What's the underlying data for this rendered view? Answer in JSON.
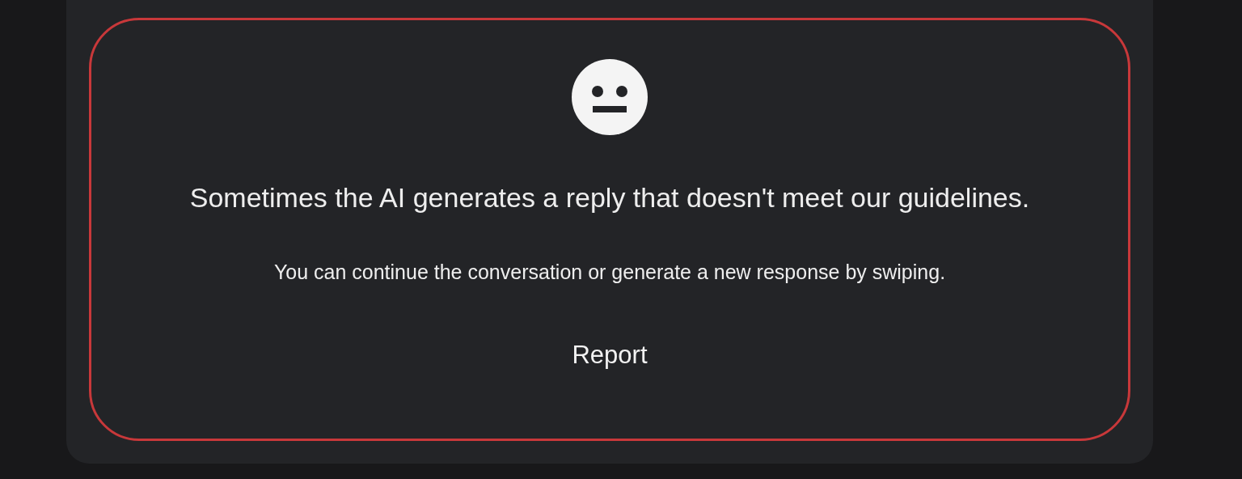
{
  "notice": {
    "title": "Sometimes the AI generates a reply that doesn't meet our guidelines.",
    "subtitle": "You can continue the conversation or generate a new response by swiping.",
    "report_button": "Report"
  }
}
